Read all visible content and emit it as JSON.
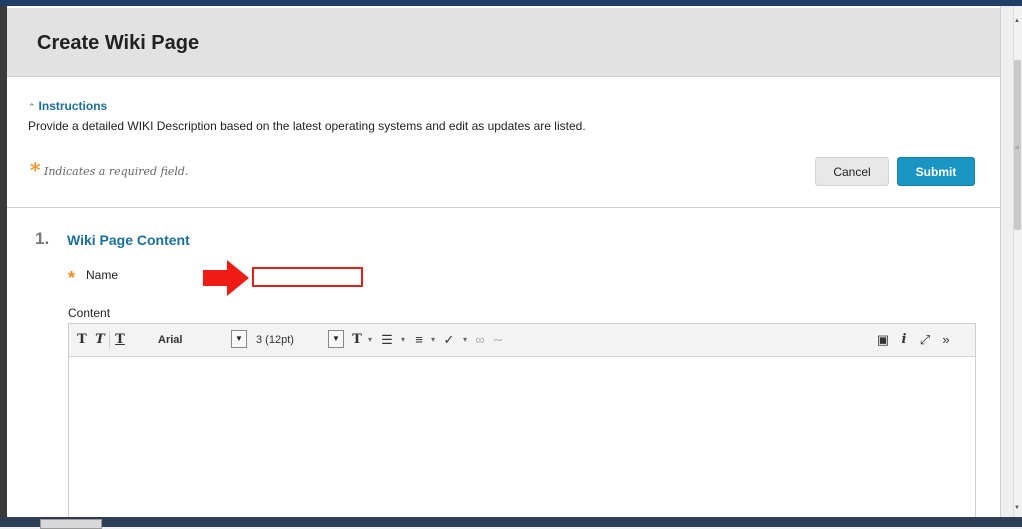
{
  "page": {
    "title": "Create Wiki Page"
  },
  "instructions": {
    "toggle_label": "Instructions",
    "text": "Provide a detailed WIKI Description based on the latest operating systems and edit as updates are listed."
  },
  "required_note": "Indicates a required field.",
  "actions": {
    "cancel_label": "Cancel",
    "submit_label": "Submit"
  },
  "section": {
    "number": "1.",
    "title": "Wiki Page Content"
  },
  "fields": {
    "name": {
      "label": "Name",
      "value": "",
      "placeholder": ""
    },
    "content": {
      "label": "Content"
    }
  },
  "toolbar": {
    "font_family": "Arial",
    "font_size": "3 (12pt)",
    "icons": [
      "text-bold-icon",
      "text-italic-icon",
      "text-underline-icon",
      "font-color-icon",
      "bullet-list-icon",
      "numbered-list-icon",
      "spellcheck-icon",
      "insert-link-icon",
      "unlink-icon",
      "preview-icon",
      "info-icon",
      "fullscreen-icon",
      "more-tools-icon"
    ]
  },
  "colors": {
    "accent": "#1a94c2",
    "link": "#1a6f9c",
    "required": "#f08c1e",
    "highlight": "#e0201a"
  }
}
